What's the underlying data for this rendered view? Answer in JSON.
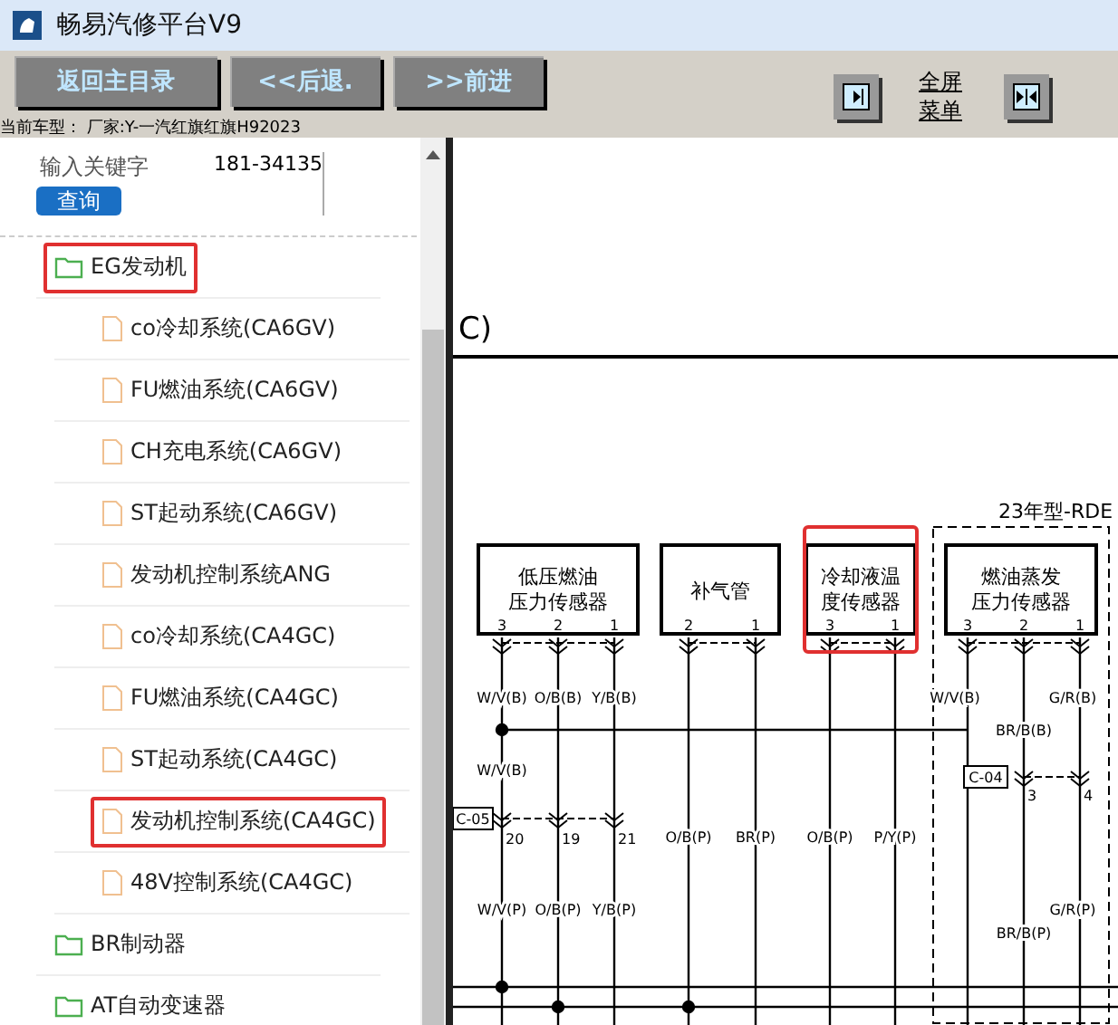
{
  "window": {
    "title": "畅易汽修平台V9"
  },
  "toolbar": {
    "buttons": [
      "返回主目录",
      "<<后退.",
      ">>前进"
    ],
    "menu_link": "全屏菜单"
  },
  "current_model": "当前车型： 厂家:Y-一汽红旗红旗H92023",
  "search": {
    "label": "输入关键字",
    "value": "181-34135",
    "button": "查询"
  },
  "tree": [
    {
      "label": "EG发动机",
      "kind": "folder",
      "highlighted": true,
      "children": [
        {
          "label": "co冷却系统(CA6GV)",
          "kind": "document",
          "highlighted": false
        },
        {
          "label": "FU燃油系统(CA6GV)",
          "kind": "document",
          "highlighted": false
        },
        {
          "label": "CH充电系统(CA6GV)",
          "kind": "document",
          "highlighted": false
        },
        {
          "label": "ST起动系统(CA6GV)",
          "kind": "document",
          "highlighted": false
        },
        {
          "label": "发动机控制系统ANG",
          "kind": "document",
          "highlighted": false
        },
        {
          "label": "co冷却系统(CA4GC)",
          "kind": "document",
          "highlighted": false
        },
        {
          "label": "FU燃油系统(CA4GC)",
          "kind": "document",
          "highlighted": false
        },
        {
          "label": "ST起动系统(CA4GC)",
          "kind": "document",
          "highlighted": false
        },
        {
          "label": "发动机控制系统(CA4GC)",
          "kind": "document",
          "highlighted": true
        },
        {
          "label": "48V控制系统(CA4GC)",
          "kind": "document",
          "highlighted": false
        }
      ]
    },
    {
      "label": "BR制动器",
      "kind": "folder",
      "highlighted": false
    },
    {
      "label": "AT自动变速器",
      "kind": "folder",
      "highlighted": false
    }
  ],
  "diagram": {
    "heading": "C)",
    "group_label": "23年型-RDE",
    "components": [
      {
        "lines": [
          "低压燃油",
          "压力传感器"
        ],
        "pins": [
          "3",
          "2",
          "1"
        ],
        "highlighted": false
      },
      {
        "lines": [
          "补气管"
        ],
        "pins": [
          "2",
          "1"
        ],
        "highlighted": false
      },
      {
        "lines": [
          "冷却液温",
          "度传感器"
        ],
        "pins": [
          "3",
          "1"
        ],
        "highlighted": true
      },
      {
        "lines": [
          "燃油蒸发",
          "压力传感器"
        ],
        "pins": [
          "3",
          "2",
          "1"
        ],
        "highlighted": false
      }
    ],
    "wire_labels": [
      "W/V(B)",
      "O/B(B)",
      "Y/B(B)",
      "W/V(B)",
      "G/R(B)",
      "BR/B(B)",
      "W/V(B)",
      "O/B(P)",
      "BR(P)",
      "O/B(P)",
      "P/Y(P)",
      "W/V(P)",
      "O/B(P)",
      "Y/B(P)",
      "G/R(P)",
      "BR/B(P)"
    ],
    "connectors": [
      {
        "name": "C-05",
        "pins": [
          "20",
          "19",
          "21"
        ]
      },
      {
        "name": "C-04",
        "pins": [
          "3",
          "4"
        ]
      }
    ]
  }
}
